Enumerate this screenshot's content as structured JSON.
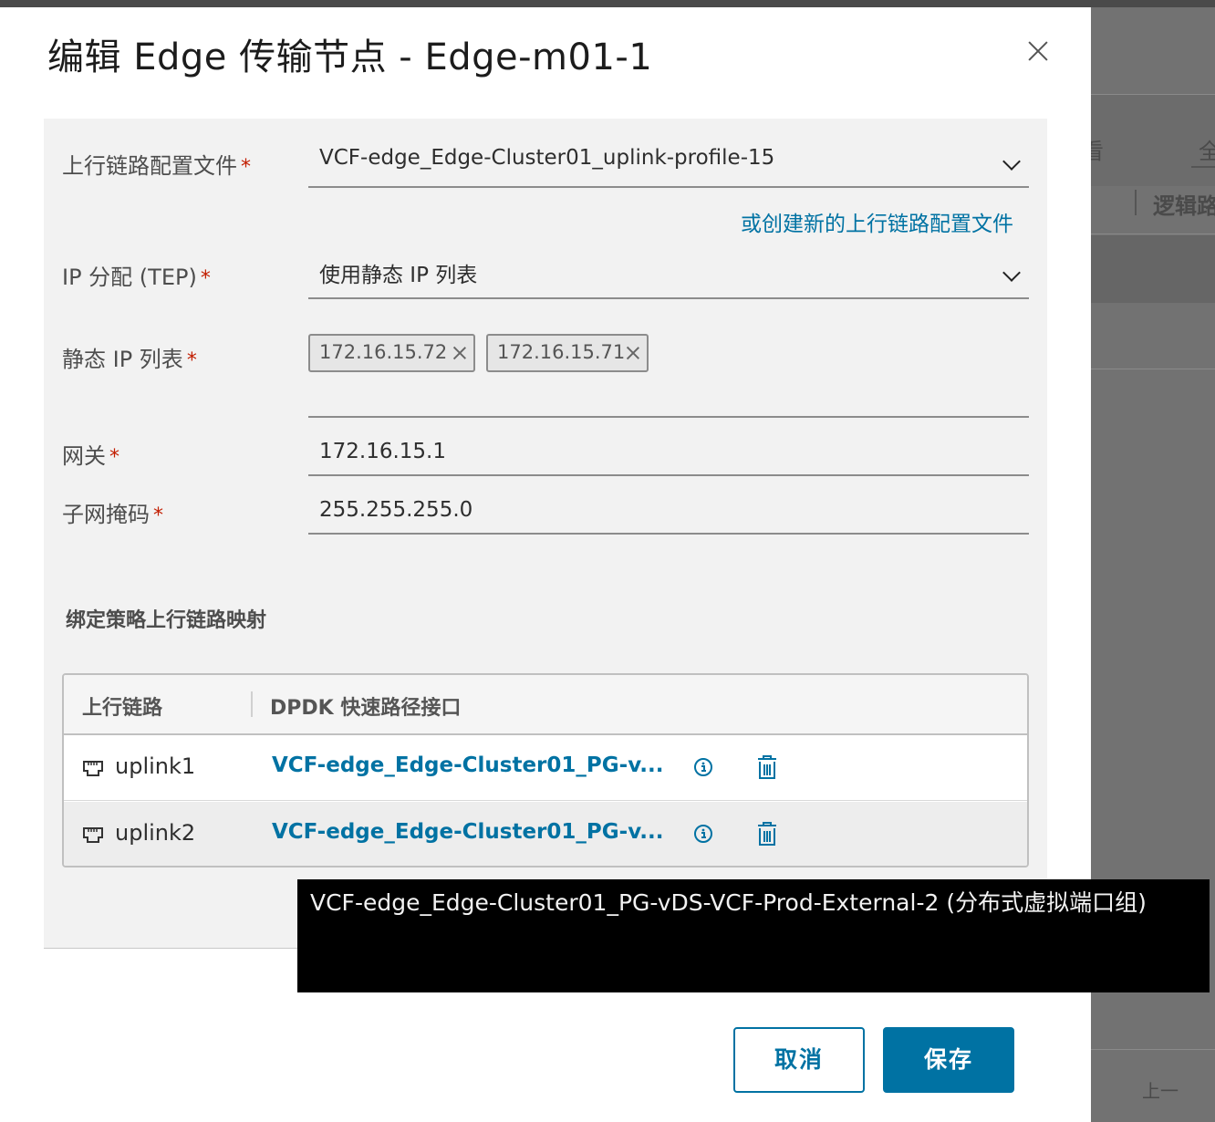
{
  "dialog": {
    "title": "编辑 Edge 传输节点 - Edge-m01-1",
    "close_icon": "close-icon"
  },
  "form": {
    "uplink_profile": {
      "label": "上行链路配置文件",
      "required_mark": "*",
      "value": "VCF-edge_Edge-Cluster01_uplink-profile-15",
      "create_link": "或创建新的上行链路配置文件"
    },
    "ip_assignment": {
      "label": "IP 分配 (TEP)",
      "required_mark": "*",
      "value": "使用静态 IP 列表"
    },
    "static_ip_list": {
      "label": "静态 IP 列表",
      "required_mark": "*",
      "tags": [
        "172.16.15.72",
        "172.16.15.71"
      ]
    },
    "gateway": {
      "label": "网关",
      "required_mark": "*",
      "value": "172.16.15.1"
    },
    "subnet_mask": {
      "label": "子网掩码",
      "required_mark": "*",
      "value": "255.255.255.0"
    }
  },
  "mapping": {
    "title": "绑定策略上行链路映射",
    "columns": [
      "上行链路",
      "DPDK 快速路径接口"
    ],
    "rows": [
      {
        "uplink": "uplink1",
        "interface": "VCF-edge_Edge-Cluster01_PG-v..."
      },
      {
        "uplink": "uplink2",
        "interface": "VCF-edge_Edge-Cluster01_PG-v..."
      }
    ]
  },
  "tooltip": {
    "text": "VCF-edge_Edge-Cluster01_PG-vDS-VCF-Prod-External-2 (分布式虚拟端口组)"
  },
  "buttons": {
    "cancel": "取消",
    "save": "保存"
  },
  "background": {
    "partial_texts": [
      "看",
      "全",
      "逻辑路",
      "上一"
    ]
  },
  "colors": {
    "accent": "#0072a3",
    "required": "#c21d00",
    "tooltip_bg": "#000000"
  }
}
